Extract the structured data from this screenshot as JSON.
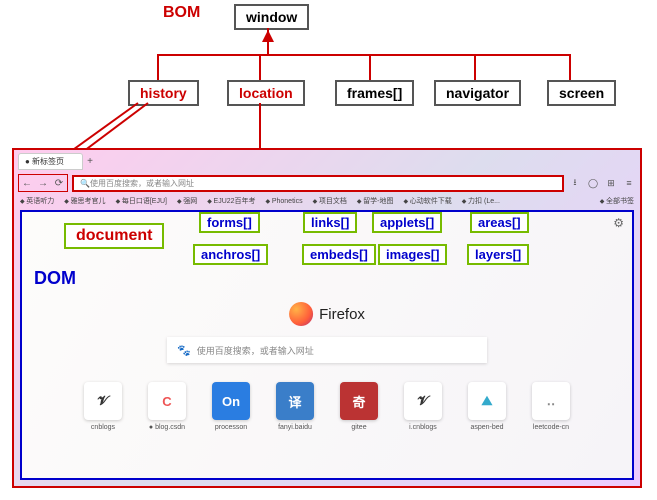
{
  "bom_label": "BOM",
  "dom_label": "DOM",
  "window_label": "window",
  "history_label": "history",
  "location_label": "location",
  "frames_label": "frames[]",
  "navigator_label": "navigator",
  "screen_label": "screen",
  "document_label": "document",
  "dom_collections": {
    "forms": "forms[]",
    "links": "links[]",
    "applets": "applets[]",
    "areas": "areas[]",
    "anchros": "anchros[]",
    "embeds": "embeds[]",
    "images": "images[]",
    "layers": "layers[]"
  },
  "browser": {
    "tab_title": "● 新标签页",
    "addr_placeholder": "使用百度搜索，或者输入网址",
    "bookmarks": [
      "英语听力",
      "雅思考官儿",
      "每日口语[EJU]",
      "强网",
      "EJU22百年考",
      "Phonetics",
      "项目文档",
      "留学-地图",
      "心动软件下载",
      "力扣 (Le...",
      "全部书签"
    ],
    "firefox_name": "Firefox",
    "search_placeholder": "使用百度搜索，或者输入网址",
    "tiles": [
      {
        "icon": "𝓥",
        "color": "#333",
        "label": "cnblogs"
      },
      {
        "icon": "C",
        "color": "#e55",
        "label": "● blog.csdn"
      },
      {
        "icon": "On",
        "color": "#fff",
        "bg": "#2a7de1",
        "label": "processon"
      },
      {
        "icon": "译",
        "color": "#fff",
        "bg": "#3a7ec9",
        "label": "fanyi.baidu"
      },
      {
        "icon": "奇",
        "color": "#fff",
        "bg": "#b33",
        "label": "gitee"
      },
      {
        "icon": "𝓥",
        "color": "#333",
        "label": "i.cnblogs"
      },
      {
        "icon": "⛰",
        "color": "#3ac",
        "label": "aspen-bed"
      },
      {
        "icon": "‥",
        "color": "#888",
        "label": "leetcode-cn"
      }
    ]
  }
}
